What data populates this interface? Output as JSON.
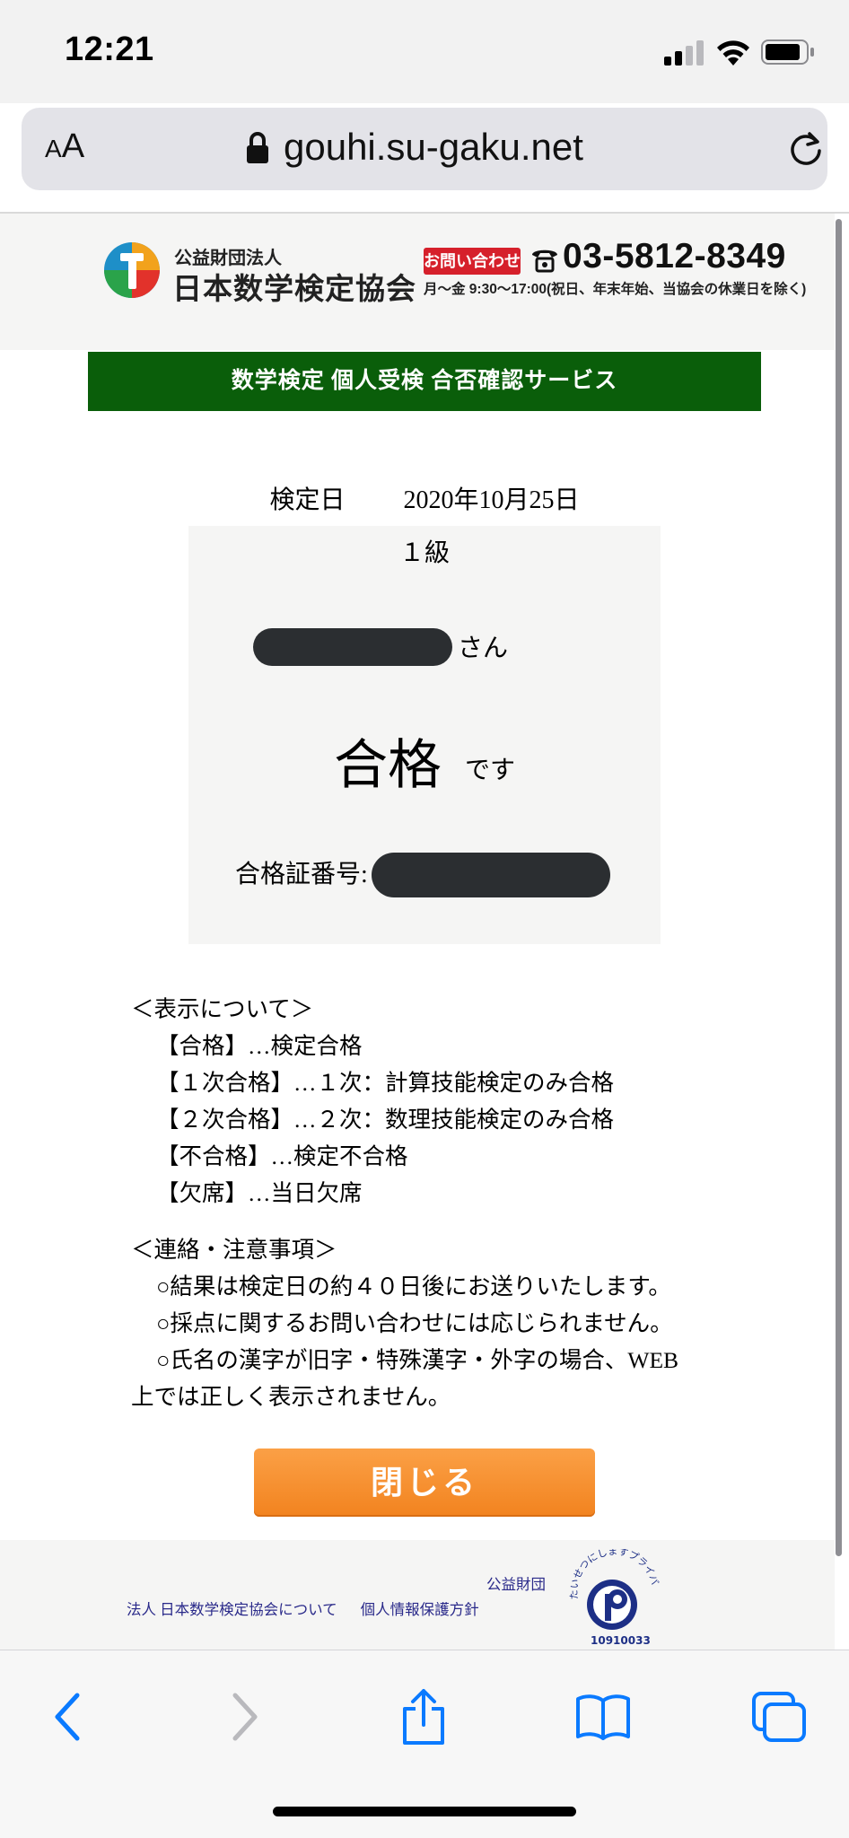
{
  "status_bar": {
    "time": "12:21"
  },
  "browser": {
    "text_size_small": "A",
    "text_size_big": "A",
    "url": "gouhi.su-gaku.net"
  },
  "header": {
    "org_type": "公益財団法人",
    "org_name": "日本数学検定協会",
    "contact_badge": "お問い合わせ",
    "phone": "03-5812-8349",
    "hours": "月～金 9:30～17:00(祝日、年末年始、当協会の休業日を除く)"
  },
  "page_title": "数学検定 個人受検 合否確認サービス",
  "result": {
    "exam_date_label": "検定日",
    "exam_date": "2020年10月25日",
    "grade": "１級",
    "honorific": "さん",
    "result_text": "合格",
    "result_suffix": "です",
    "certificate_label": "合格証番号:"
  },
  "notes": {
    "display_heading": "＜表示について＞",
    "display_items": [
      "【合格】…検定合格",
      "【１次合格】…１次：計算技能検定のみ合格",
      "【２次合格】…２次：数理技能検定のみ合格",
      "【不合格】…検定不合格",
      "【欠席】…当日欠席"
    ],
    "caution_heading": "＜連絡・注意事項＞",
    "caution_items": [
      "○結果は検定日の約４０日後にお送りいたします。",
      "○採点に関するお問い合わせには応じられません。",
      "○氏名の漢字が旧字・特殊漢字・外字の場合、WEB"
    ],
    "caution_continuation": "上では正しく表示されません。"
  },
  "close_button": "閉じる",
  "footer": {
    "org_prefix": "公益財団",
    "about_link": "法人 日本数学検定協会について",
    "privacy_link": "個人情報保護方針",
    "pmark_caption": "たいせつにしますプライバシー",
    "pmark_number": "10910033"
  },
  "colors": {
    "title_band": "#0a5e0a",
    "close_button": "#f2831f",
    "contact_badge": "#d6202b",
    "footer_link": "#2a2a8a",
    "ios_tint": "#0a7aff"
  }
}
